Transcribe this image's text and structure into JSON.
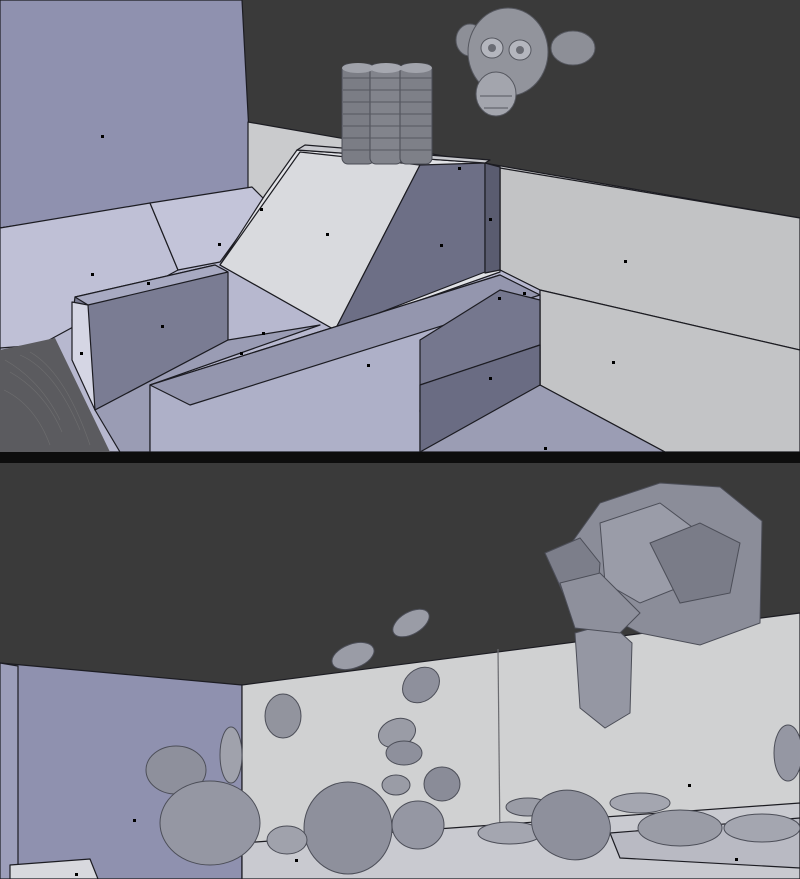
{
  "viewports": [
    {
      "id": "top",
      "description_shown_in_pixels": "",
      "objects": [
        "monkey-head",
        "stacked-discs",
        "wedge-block",
        "steps",
        "floor",
        "walls"
      ]
    },
    {
      "id": "bottom",
      "description_shown_in_pixels": "",
      "objects": [
        "monkey-head",
        "scattered-discs",
        "floor",
        "walls"
      ]
    }
  ],
  "colors": {
    "ceiling": "#3b3b3b",
    "wall_blue": "#8e90ad",
    "floor_light": "#c9cad7",
    "floor_grey": "#cfd0d0",
    "mesh_grey": "#8a8c96",
    "divider": "#0d0d0d"
  }
}
